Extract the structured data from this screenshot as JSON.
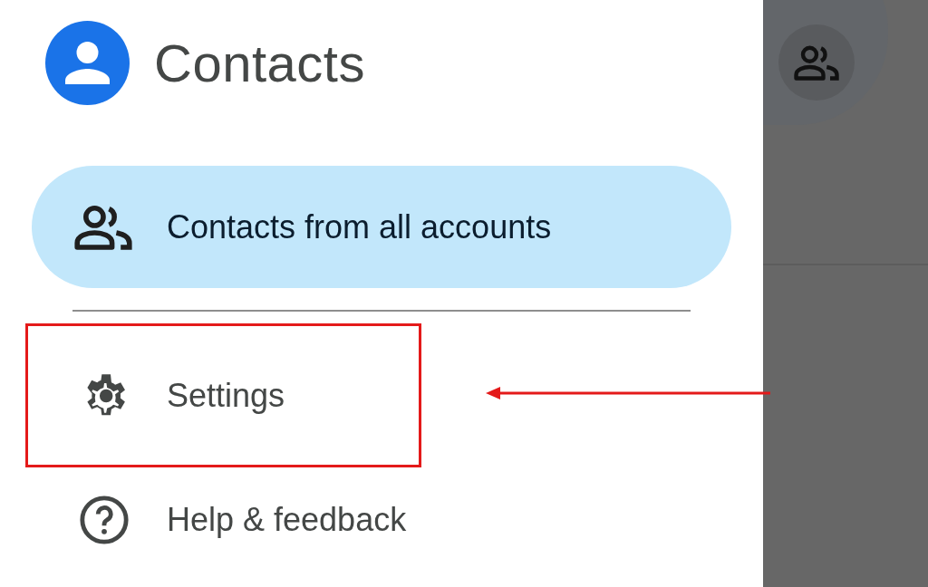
{
  "app": {
    "title": "Contacts"
  },
  "nav_items": [
    {
      "label": "Contacts from all accounts",
      "kind": "people",
      "selected": true,
      "highlighted": false
    }
  ],
  "menu_items": [
    {
      "label": "Settings",
      "kind": "settings",
      "selected": false,
      "highlighted": true
    },
    {
      "label": "Help & feedback",
      "kind": "help",
      "selected": false,
      "highlighted": false
    }
  ]
}
